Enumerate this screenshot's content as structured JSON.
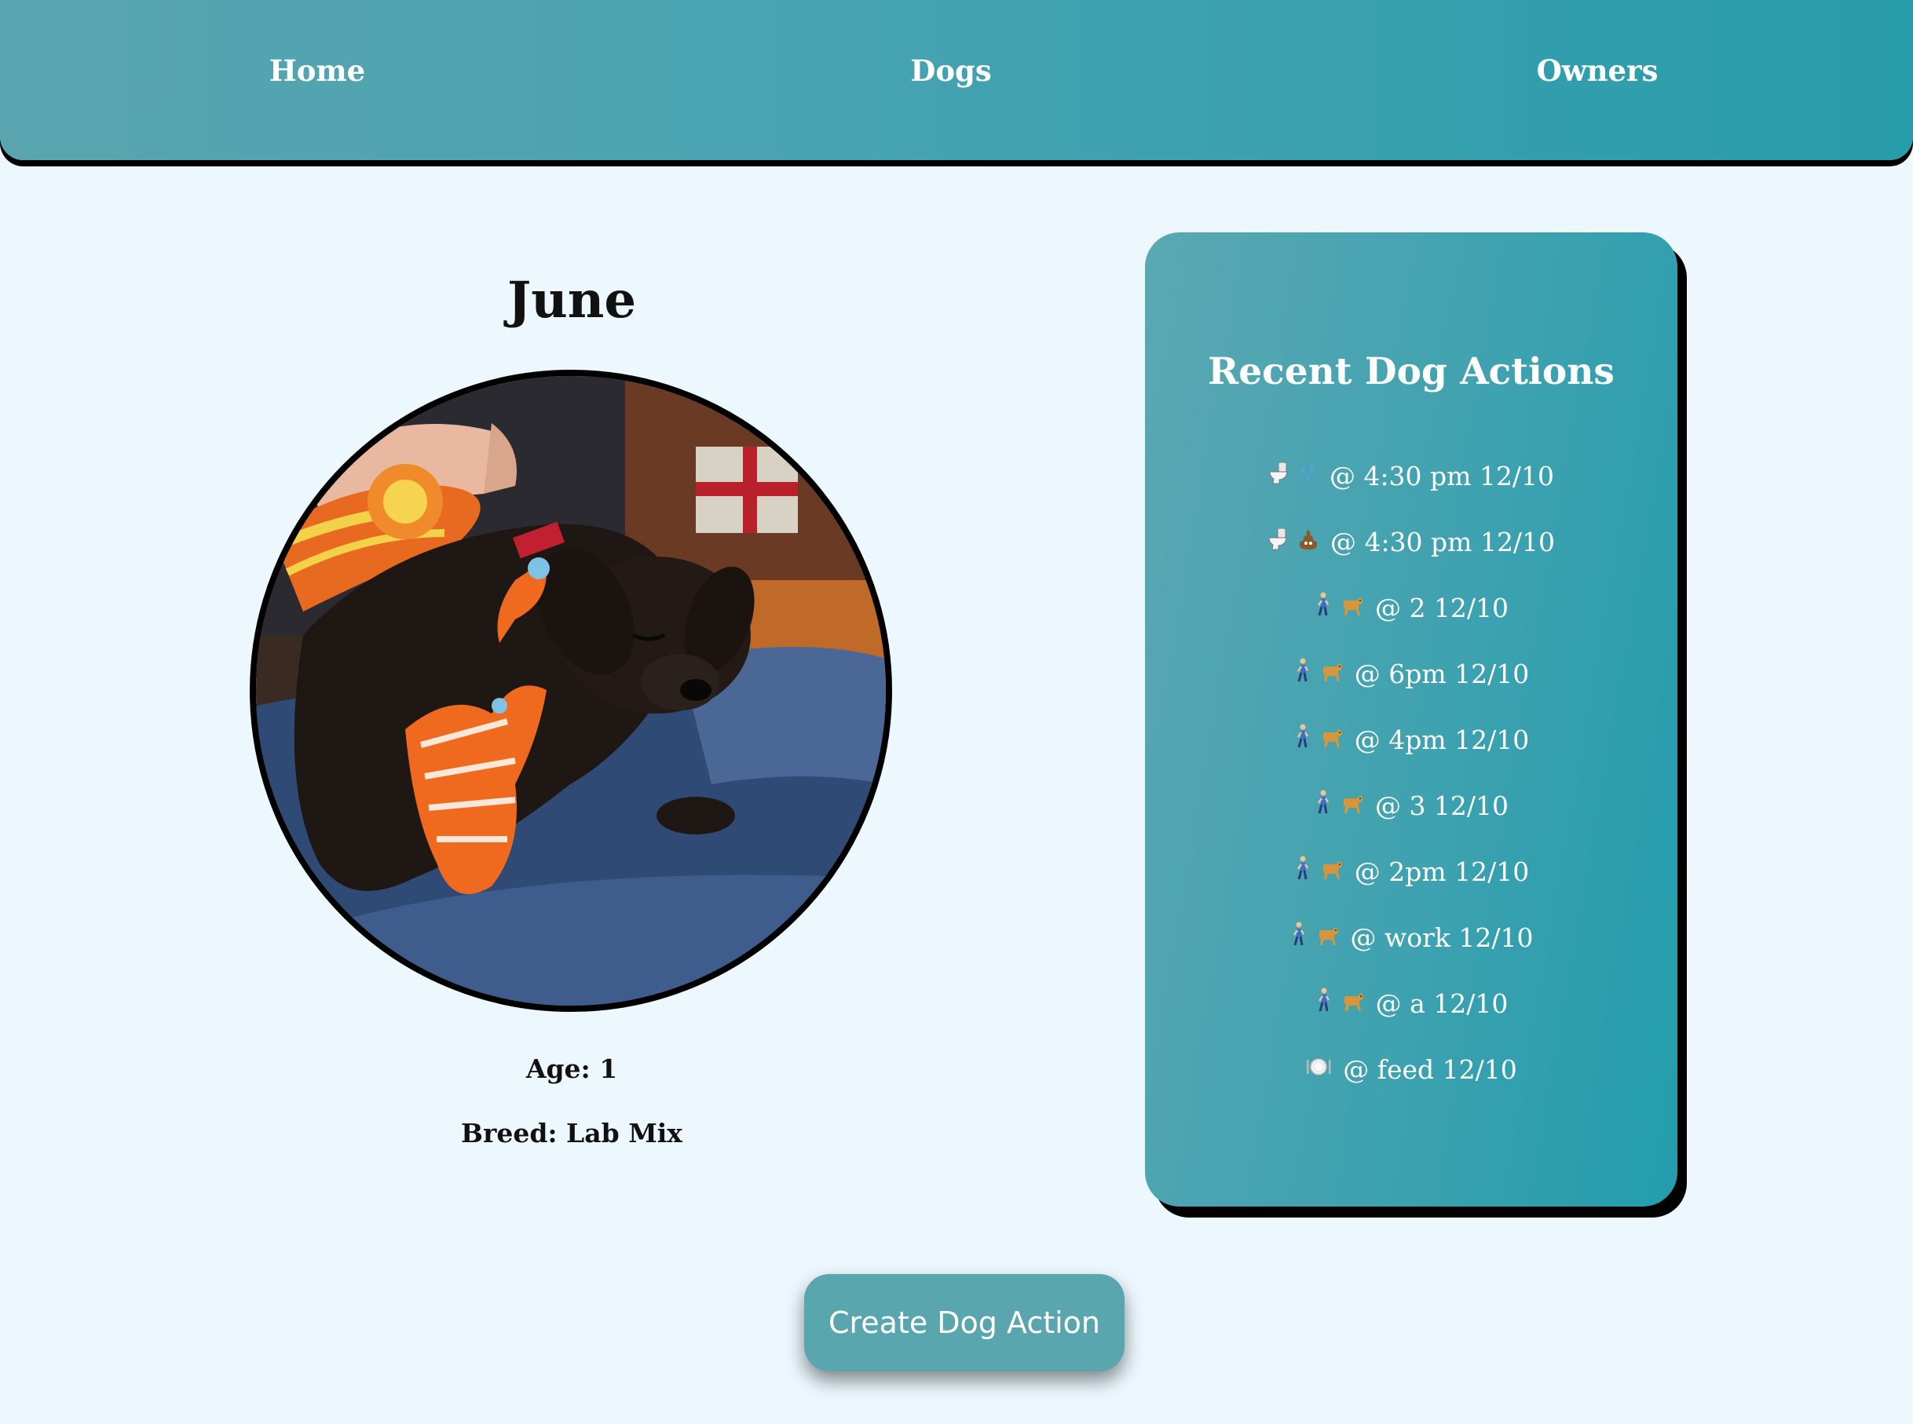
{
  "nav": {
    "home": "Home",
    "dogs": "Dogs",
    "owners": "Owners"
  },
  "dog": {
    "name": "June",
    "age_text": "Age: 1",
    "breed_text": "Breed: Lab Mix",
    "photo_description": "black lab puppy with orange rope toy on lap"
  },
  "actions_card": {
    "title": "Recent Dog Actions",
    "items": [
      {
        "icons": [
          "toilet-icon",
          "droplets-icon"
        ],
        "text": "@ 4:30 pm 12/10"
      },
      {
        "icons": [
          "toilet-icon",
          "poop-icon"
        ],
        "text": "@ 4:30 pm 12/10"
      },
      {
        "icons": [
          "walking-person-icon",
          "dog-icon"
        ],
        "text": "@ 2 12/10"
      },
      {
        "icons": [
          "walking-person-icon",
          "dog-icon"
        ],
        "text": "@ 6pm 12/10"
      },
      {
        "icons": [
          "walking-person-icon",
          "dog-icon"
        ],
        "text": "@ 4pm 12/10"
      },
      {
        "icons": [
          "walking-person-icon",
          "dog-icon"
        ],
        "text": "@ 3 12/10"
      },
      {
        "icons": [
          "walking-person-icon",
          "dog-icon"
        ],
        "text": "@ 2pm 12/10"
      },
      {
        "icons": [
          "walking-person-icon",
          "dog-icon"
        ],
        "text": "@ work 12/10"
      },
      {
        "icons": [
          "walking-person-icon",
          "dog-icon"
        ],
        "text": "@ a 12/10"
      },
      {
        "icons": [
          "plate-icon"
        ],
        "text": "@ feed 12/10"
      }
    ]
  },
  "buttons": {
    "create": "Create Dog Action"
  },
  "colors": {
    "background": "#ecf8fd",
    "nav_gradient_start": "#58a5af",
    "nav_gradient_end": "#279cab",
    "button": "#5aa6ae",
    "text_dark": "#111111",
    "text_light": "#ffffff"
  }
}
